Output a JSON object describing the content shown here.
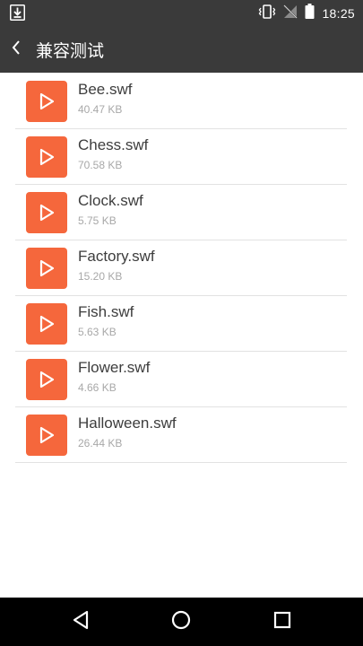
{
  "status_bar": {
    "time": "18:25",
    "left_icon": "download-icon",
    "right_icons": [
      "vibrate-icon",
      "no-signal-icon",
      "battery-icon"
    ]
  },
  "toolbar": {
    "title": "兼容测试",
    "back_icon": "chevron-left-icon"
  },
  "colors": {
    "toolbar_bg": "#3a3a3a",
    "file_icon_bg": "#f5673c",
    "nav_bar_bg": "#000000"
  },
  "files": [
    {
      "name": "Bee.swf",
      "size": "40.47 KB",
      "icon": "play-icon"
    },
    {
      "name": "Chess.swf",
      "size": "70.58 KB",
      "icon": "play-icon"
    },
    {
      "name": "Clock.swf",
      "size": "5.75 KB",
      "icon": "play-icon"
    },
    {
      "name": "Factory.swf",
      "size": "15.20 KB",
      "icon": "play-icon"
    },
    {
      "name": "Fish.swf",
      "size": "5.63 KB",
      "icon": "play-icon"
    },
    {
      "name": "Flower.swf",
      "size": "4.66 KB",
      "icon": "play-icon"
    },
    {
      "name": "Halloween.swf",
      "size": "26.44 KB",
      "icon": "play-icon"
    }
  ],
  "nav_bar": {
    "buttons": [
      "back-triangle-icon",
      "home-circle-icon",
      "recents-square-icon"
    ]
  }
}
